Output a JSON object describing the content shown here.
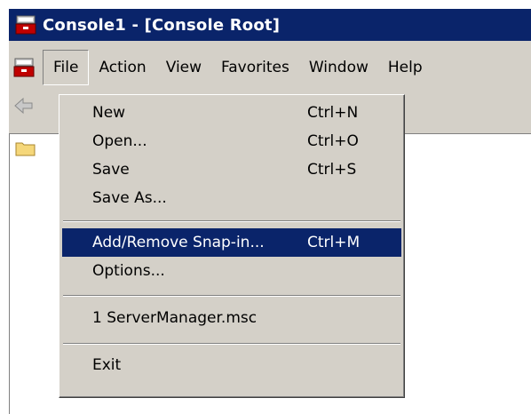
{
  "window": {
    "title": "Console1 - [Console Root]"
  },
  "menubar": {
    "items": [
      "File",
      "Action",
      "View",
      "Favorites",
      "Window",
      "Help"
    ]
  },
  "tree": {
    "root_icon": "folder-icon"
  },
  "file_menu": {
    "items": [
      {
        "label": "New",
        "shortcut": "Ctrl+N"
      },
      {
        "label": "Open...",
        "shortcut": "Ctrl+O"
      },
      {
        "label": "Save",
        "shortcut": "Ctrl+S"
      },
      {
        "label": "Save As...",
        "shortcut": ""
      },
      {
        "label": "Add/Remove Snap-in...",
        "shortcut": "Ctrl+M"
      },
      {
        "label": "Options...",
        "shortcut": ""
      },
      {
        "label": "1 ServerManager.msc",
        "shortcut": ""
      },
      {
        "label": "Exit",
        "shortcut": ""
      }
    ],
    "highlighted": "Add/Remove Snap-in..."
  },
  "colors": {
    "titlebar": "#0a246a",
    "highlight": "#0a246a",
    "face": "#d4d0c8"
  },
  "icons": {
    "app": "mmc-toolbox-icon",
    "back": "back-arrow-icon"
  }
}
